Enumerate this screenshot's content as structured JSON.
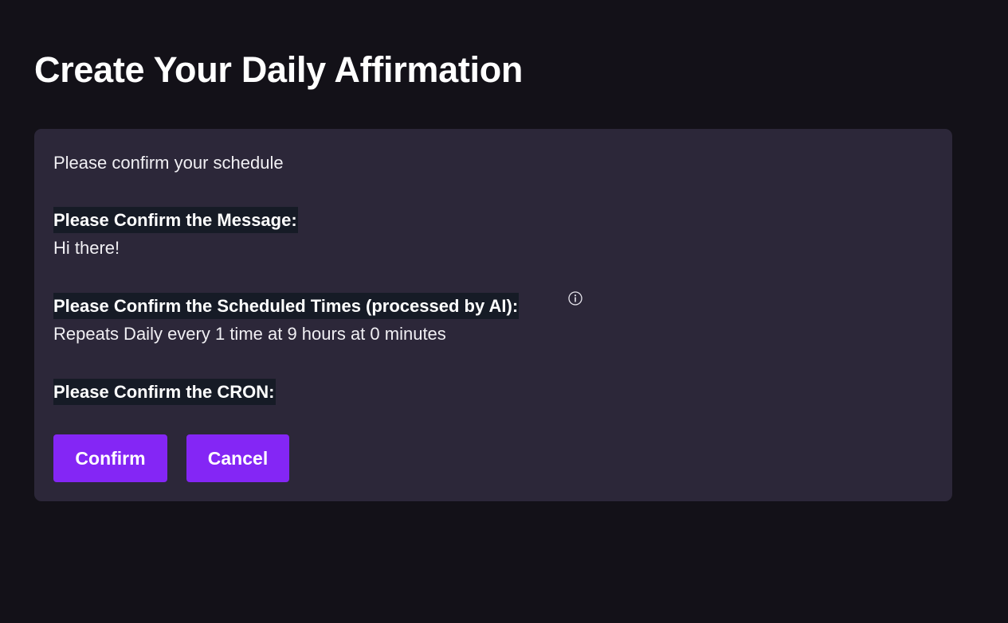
{
  "page": {
    "title": "Create Your Daily Affirmation"
  },
  "card": {
    "intro": "Please confirm your schedule",
    "message_label": "Please Confirm the Message:",
    "message_value": "Hi there!",
    "times_label": "Please Confirm the Scheduled Times (processed by AI):",
    "times_value": "Repeats Daily every 1 time at 9 hours at 0 minutes",
    "cron_label": "Please Confirm the CRON:",
    "cron_value": "",
    "info_icon": "info-icon"
  },
  "actions": {
    "confirm_label": "Confirm",
    "cancel_label": "Cancel"
  },
  "colors": {
    "background": "#131118",
    "card": "#2c2739",
    "label_highlight": "#161b26",
    "accent": "#8426f5"
  }
}
